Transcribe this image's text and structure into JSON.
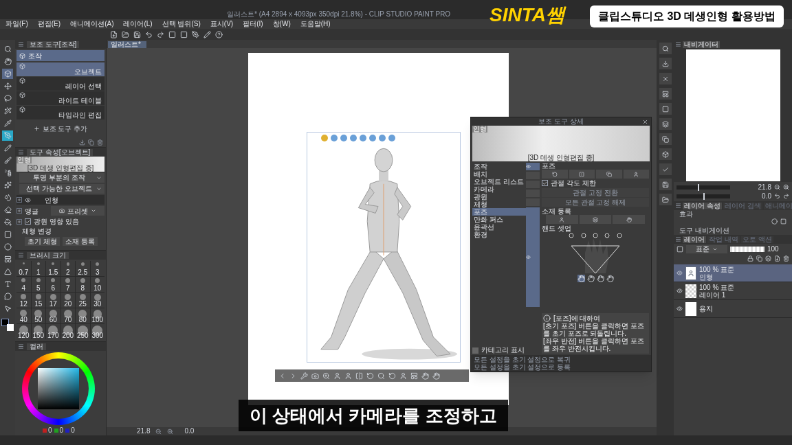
{
  "window": {
    "title": "일러스트* (A4 2894 x 4093px 350dpi 21.8%) - CLIP STUDIO PAINT PRO"
  },
  "overlay": {
    "logo": "SINTA쌤",
    "banner": "클립스튜디오 3D 데생인형 활용방법",
    "subtitle": "이 상태에서 카메라를 조정하고"
  },
  "menu": [
    "파일(F)",
    "편집(E)",
    "애니메이션(A)",
    "레이어(L)",
    "선택 범위(S)",
    "표시(V)",
    "필터(I)",
    "창(W)",
    "도움말(H)"
  ],
  "tools": [
    {
      "selected": false,
      "hovered": false
    },
    {
      "selected": false,
      "hovered": false
    },
    {
      "selected": true,
      "hovered": false
    },
    {
      "selected": false,
      "hovered": false
    },
    {
      "selected": false,
      "hovered": false
    },
    {
      "selected": false,
      "hovered": false
    },
    {
      "selected": false,
      "hovered": false
    },
    {
      "selected": false,
      "hovered": true
    },
    {
      "selected": false,
      "hovered": false
    },
    {
      "selected": false,
      "hovered": false
    },
    {
      "selected": false,
      "hovered": false
    },
    {
      "selected": false,
      "hovered": false
    },
    {
      "selected": false,
      "hovered": false
    },
    {
      "selected": false,
      "hovered": false
    },
    {
      "selected": false,
      "hovered": false
    },
    {
      "selected": false,
      "hovered": false
    },
    {
      "selected": false,
      "hovered": false
    },
    {
      "selected": false,
      "hovered": false
    },
    {
      "selected": false,
      "hovered": false
    },
    {
      "selected": false,
      "hovered": false
    },
    {
      "selected": false,
      "hovered": false
    },
    {
      "selected": false,
      "hovered": false
    }
  ],
  "sub_tool": {
    "title": "보조 도구[조작]",
    "group": "조작",
    "add": "보조 도구 추가",
    "items": [
      {
        "label": "오브젝트",
        "selected": true
      },
      {
        "label": "레이어 선택",
        "selected": false
      },
      {
        "label": "라이트 테이블",
        "selected": false
      },
      {
        "label": "타임라인 편집",
        "selected": false
      }
    ]
  },
  "tool_property": {
    "title": "도구 속성[오브젝트]",
    "preview_label": "인형",
    "preview_caption": "[3D 데생 인형편집 중]",
    "rows": [
      {
        "kind": "dropdown",
        "label": "투명 부분의 조작"
      },
      {
        "kind": "dropdown",
        "label": "선택 가능한 오브젝트"
      },
      {
        "kind": "object",
        "label": "인형",
        "visible": true
      },
      {
        "kind": "angle",
        "label": "앵글",
        "value": "프리셋"
      },
      {
        "kind": "checkbox",
        "label": "광원 영향 있음",
        "checked": true
      },
      {
        "kind": "heading",
        "label": "체형 변경"
      },
      {
        "kind": "buttons",
        "buttons": [
          "초기 체형",
          "소재 등록"
        ]
      }
    ]
  },
  "brush_size": {
    "title": "브러시 크기",
    "sizes": [
      "0.7",
      "1",
      "1.5",
      "2",
      "2.5",
      "3",
      "4",
      "5",
      "6",
      "7",
      "8",
      "10",
      "12",
      "15",
      "17",
      "20",
      "25",
      "30",
      "40",
      "50",
      "60",
      "70",
      "80",
      "100",
      "120",
      "150",
      "170",
      "200",
      "250",
      "300"
    ]
  },
  "color_panel": {
    "tab": "컬러",
    "readings": [
      "0",
      "0",
      "0"
    ]
  },
  "canvas": {
    "tab": "일러스트*",
    "zoom": "21.8",
    "rotation": "0.0"
  },
  "detail": {
    "title": "보조 도구 상세",
    "preview_label": "인형",
    "preview_caption": "[3D 데생 인형편집 중]",
    "categories": [
      {
        "label": "조작",
        "selected": false
      },
      {
        "label": "배치",
        "selected": false
      },
      {
        "label": "오브젝트 리스트",
        "selected": false
      },
      {
        "label": "카메라",
        "selected": false
      },
      {
        "label": "광원",
        "selected": false
      },
      {
        "label": "체형",
        "selected": false
      },
      {
        "label": "포즈",
        "selected": true
      },
      {
        "label": "만화 퍼스",
        "selected": false
      },
      {
        "label": "윤곽선",
        "selected": false
      },
      {
        "label": "환경",
        "selected": false
      }
    ],
    "toggles": [
      {
        "on": true
      },
      {
        "on": false
      },
      {
        "on": false
      },
      {
        "on": false
      },
      {
        "on": false
      },
      {
        "on": true
      }
    ],
    "pose_heading": "포즈",
    "joint_limit": {
      "label": "관절 각도 제한",
      "checked": true
    },
    "joint_buttons": [
      "관절 고정 전환",
      "모든 관절 고정 해제"
    ],
    "material_heading": "소재 등록",
    "hand_heading": "핸드 셋업",
    "info_title": "[포즈]에 대하여",
    "info_lines": [
      "[초기 포즈] 버튼을 클릭하면 포즈를 초기 포즈로 되돌립니다.",
      "[좌우 반전] 버튼을 클릭하면 포즈를 좌우 반전시킵니다."
    ],
    "category_toggle": {
      "label": "카테고리 표시",
      "checked": false
    },
    "footer": [
      "모든 설정을 초기 설정으로 복귀",
      "모든 설정을 초기 설정으로 등록"
    ]
  },
  "navigator": {
    "tabs": [
      {
        "label": "내비게이터",
        "selected": true
      }
    ],
    "zoom": "21.8",
    "zoom_slider": {
      "level": 0.4
    },
    "rotation": "0.0",
    "rotation_slider": {
      "level": 0.5
    }
  },
  "layer_property": {
    "tabs": [
      {
        "label": "레이어 속성",
        "selected": true
      },
      {
        "label": "레이어 검색",
        "selected": false
      },
      {
        "label": "애니메이",
        "selected": false
      }
    ],
    "effect": "효과",
    "navigation": "도구 내비게이션"
  },
  "layers": {
    "tabs": [
      {
        "label": "레이어",
        "selected": true
      },
      {
        "label": "작업 내역",
        "selected": false
      },
      {
        "label": "오토 액션",
        "selected": false
      }
    ],
    "blend": "표준",
    "opacity": "100",
    "opacity_slider": {
      "level": 1
    },
    "items": [
      {
        "kind": "model",
        "info": "100 % 표준",
        "name": "인형",
        "selected": true
      },
      {
        "kind": "raster",
        "info": "100 % 표준",
        "name": "레이어 1",
        "selected": false
      },
      {
        "kind": "paper",
        "name": "용지",
        "selected": false
      }
    ]
  }
}
